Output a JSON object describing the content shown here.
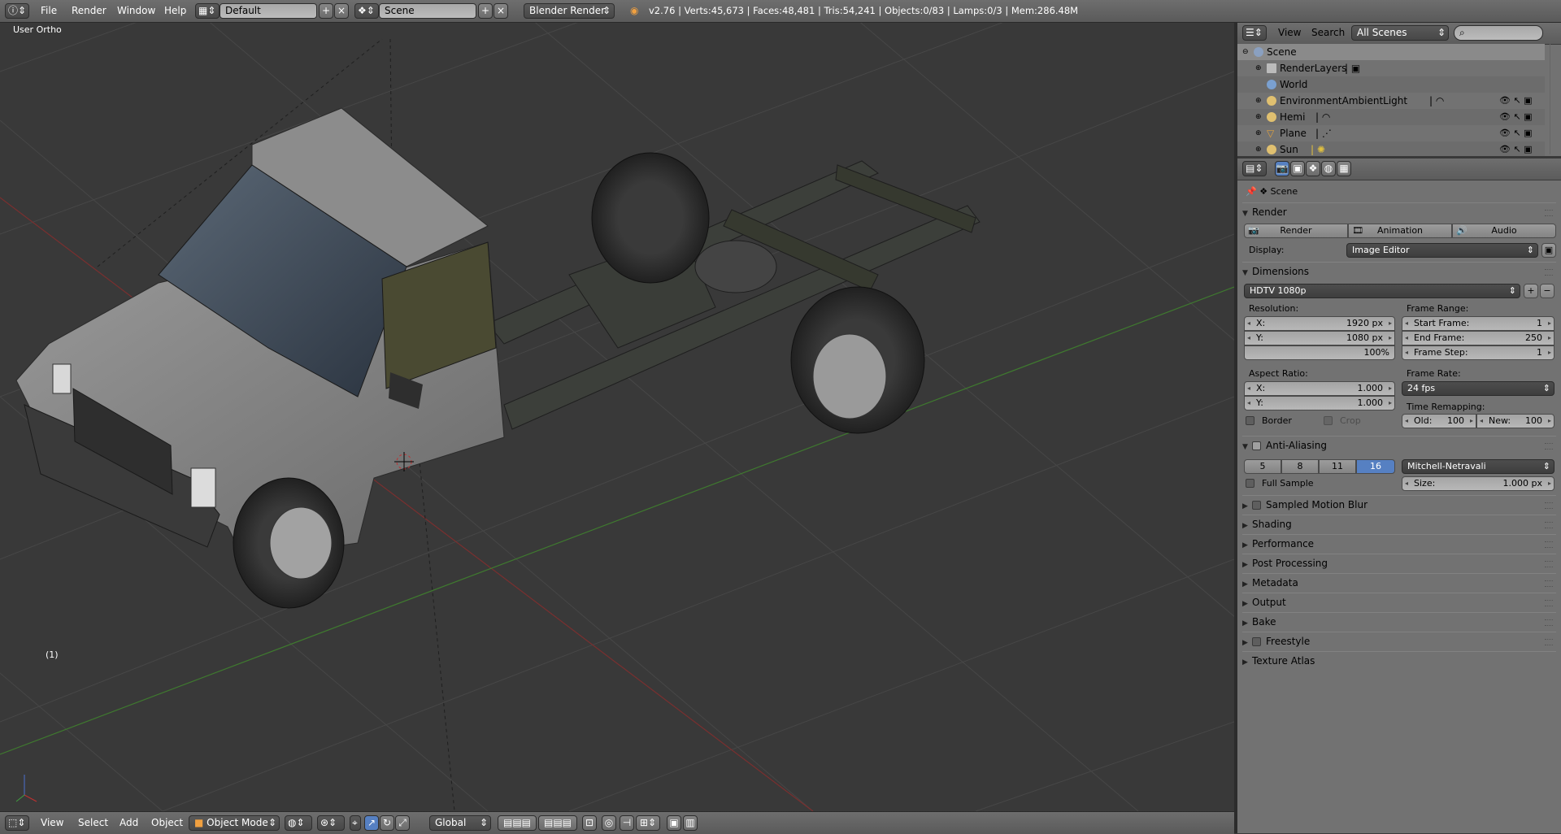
{
  "topbar": {
    "menus": [
      "File",
      "Render",
      "Window",
      "Help"
    ],
    "layout": "Default",
    "scene": "Scene",
    "engine": "Blender Render",
    "stats": "v2.76 | Verts:45,673 | Faces:48,481 | Tris:54,241 | Objects:0/83 | Lamps:0/3 | Mem:286.48M"
  },
  "viewport": {
    "view_label": "User Ortho",
    "frame_label": "(1)",
    "bottom_menus": [
      "View",
      "Select",
      "Add",
      "Object"
    ],
    "mode": "Object Mode",
    "orientation": "Global"
  },
  "outliner": {
    "menus": [
      "View",
      "Search"
    ],
    "filter": "All Scenes",
    "rows": [
      {
        "label": "Scene"
      },
      {
        "label": "RenderLayers"
      },
      {
        "label": "World"
      },
      {
        "label": "EnvironmentAmbientLight"
      },
      {
        "label": "Hemi"
      },
      {
        "label": "Plane"
      },
      {
        "label": "Sun"
      }
    ]
  },
  "properties": {
    "context": "Scene",
    "render_panel": "Render",
    "render_buttons": [
      "Render",
      "Animation",
      "Audio"
    ],
    "display_label": "Display:",
    "display_value": "Image Editor",
    "dimensions_panel": "Dimensions",
    "preset": "HDTV 1080p",
    "resolution_label": "Resolution:",
    "res_x_label": "X:",
    "res_x": "1920 px",
    "res_y_label": "Y:",
    "res_y": "1080 px",
    "res_pct": "100%",
    "frame_range_label": "Frame Range:",
    "start_label": "Start Frame:",
    "start": "1",
    "end_label": "End Frame:",
    "end": "250",
    "step_label": "Frame Step:",
    "step": "1",
    "aspect_label": "Aspect Ratio:",
    "asp_x_label": "X:",
    "asp_x": "1.000",
    "asp_y_label": "Y:",
    "asp_y": "1.000",
    "frame_rate_label": "Frame Rate:",
    "frame_rate": "24 fps",
    "time_remap_label": "Time Remapping:",
    "old_label": "Old:",
    "old": "100",
    "new_label": "New:",
    "new": "100",
    "border_label": "Border",
    "crop_label": "Crop",
    "aa_panel": "Anti-Aliasing",
    "aa_samples": [
      "5",
      "8",
      "11",
      "16"
    ],
    "aa_selected": "16",
    "aa_filter": "Mitchell-Netravali",
    "full_sample_label": "Full Sample",
    "size_label": "Size:",
    "size": "1.000 px",
    "collapsed_panels": [
      "Sampled Motion Blur",
      "Shading",
      "Performance",
      "Post Processing",
      "Metadata",
      "Output",
      "Bake",
      "Freestyle",
      "Texture Atlas"
    ]
  },
  "colors": {
    "accent_blue": "#5680c2",
    "viewport_bg": "#393939",
    "panel_bg": "#727272"
  }
}
